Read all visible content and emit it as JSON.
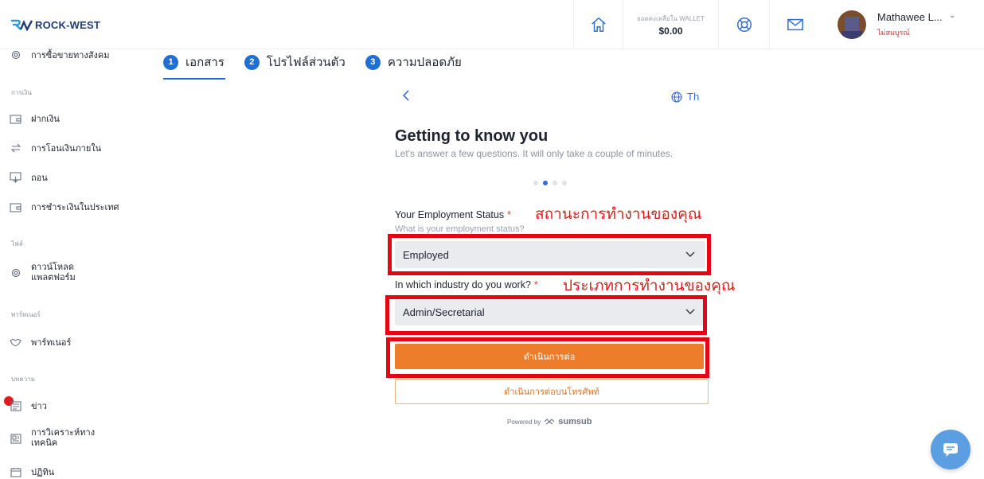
{
  "header": {
    "logo_text": "ROCK-WEST",
    "wallet_label": "ยอดคงเหลือใน WALLET",
    "wallet_amount": "$0.00",
    "user_name": "Mathawee L...",
    "user_status": "ไม่สมบูรณ์"
  },
  "sidebar": {
    "top_item": "การซื้อขายทางสังคม",
    "finance_header": "การเงิน",
    "finance_items": [
      "ฝากเงิน",
      "การโอนเงินภายใน",
      "ถอน",
      "การชำระเงินในประเทศ"
    ],
    "file_header": "ไฟล์",
    "download_line1": "ดาวน์โหลด",
    "download_line2": "แพลตฟอร์ม",
    "partner_header": "พาร์ทเนอร์",
    "partner_item": "พาร์ทเนอร์",
    "articles_header": "บทความ",
    "news_item": "ข่าว",
    "analysis_line1": "การวิเคราะห์ทาง",
    "analysis_line2": "เทคนิค",
    "calendar_item": "ปฏิทิน"
  },
  "steps": [
    {
      "num": "1",
      "label": "เอกสาร"
    },
    {
      "num": "2",
      "label": "โปรไฟล์ส่วนตัว"
    },
    {
      "num": "3",
      "label": "ความปลอดภัย"
    }
  ],
  "form": {
    "language": "Th",
    "title": "Getting to know you",
    "subtitle": "Let's answer a few questions. It will only take a couple of minutes.",
    "employment_label": "Your Employment Status",
    "employment_hint": "What is your employment status?",
    "employment_value": "Employed",
    "industry_label": "In which industry do you work?",
    "industry_value": "Admin/Secretarial",
    "required_mark": "*",
    "continue_button": "ดำเนินการต่อ",
    "continue_phone_button": "ดำเนินการต่อบนโทรศัพท์",
    "powered_by": "Powered by",
    "powered_brand": "sumsub",
    "progress_step": 2,
    "progress_total": 4
  },
  "annotations": {
    "employment_note": "สถานะการทำงานของคุณ",
    "industry_note": "ประเภทการทำงานของคุณ",
    "highlight_color": "#e30613"
  },
  "colors": {
    "accent": "#1f6fd6",
    "primary_button": "#ee7d2b",
    "brand": "#1f3b7a"
  }
}
